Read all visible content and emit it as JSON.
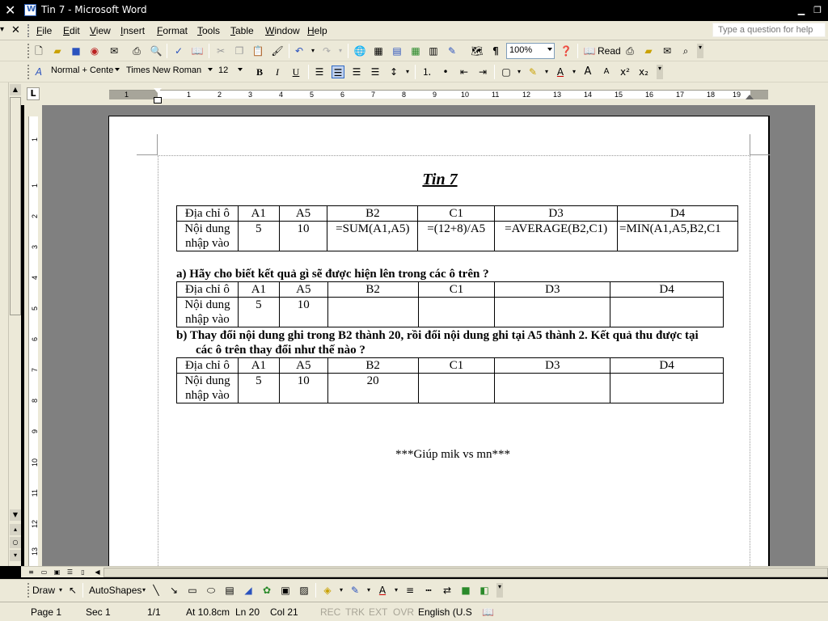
{
  "window": {
    "title": "Tin 7 - Microsoft Word"
  },
  "menu": {
    "items": [
      "File",
      "Edit",
      "View",
      "Insert",
      "Format",
      "Tools",
      "Table",
      "Window",
      "Help"
    ],
    "ask_placeholder": "Type a question for help"
  },
  "toolbar": {
    "zoom": "100%",
    "read_label": "Read",
    "style": "Normal + Cente",
    "font": "Times New Roman",
    "size": "12"
  },
  "document": {
    "title": "Tin 7",
    "table1": {
      "headers": [
        "Địa chỉ ô",
        "A1",
        "A5",
        "B2",
        "C1",
        "D3",
        "D4"
      ],
      "row_label": "Nội dung nhập vào",
      "cells": [
        "5",
        "10",
        "=SUM(A1,A5)",
        "=(12+8)/A5",
        "=AVERAGE(B2,C1)",
        "=MIN(A1,A5,B2,C1"
      ]
    },
    "question_a": "a)   Hãy cho biết kết quả gì sẽ được hiện lên trong các ô trên ?",
    "table2": {
      "headers": [
        "Địa chỉ ô",
        "A1",
        "A5",
        "B2",
        "C1",
        "D3",
        "D4"
      ],
      "row_label": "Nội dung nhập vào",
      "cells": [
        "5",
        "10",
        "",
        "",
        "",
        ""
      ]
    },
    "question_b_line1": "b)   Thay đổi nội dung ghi trong B2 thành 20, rồi đổi nội dung ghi tại A5 thành 2. Kết quả thu được tại",
    "question_b_line2": "các ô trên thay đổi như thế nào ?",
    "table3": {
      "headers": [
        "Địa chỉ ô",
        "A1",
        "A5",
        "B2",
        "C1",
        "D3",
        "D4"
      ],
      "row_label": "Nội dung nhập vào",
      "cells": [
        "5",
        "10",
        "20",
        "",
        "",
        ""
      ]
    },
    "footer_note": "***Giúp mik vs mn***"
  },
  "drawbar": {
    "draw_label": "Draw",
    "autoshapes_label": "AutoShapes"
  },
  "ruler": {
    "h_numbers": [
      "1",
      "1",
      "2",
      "3",
      "4",
      "5",
      "6",
      "7",
      "8",
      "9",
      "10",
      "11",
      "12",
      "13",
      "14",
      "15",
      "16",
      "17",
      "18",
      "19"
    ],
    "v_numbers": [
      "1",
      "1",
      "2",
      "3",
      "4",
      "5",
      "6",
      "7",
      "8",
      "9",
      "10",
      "11",
      "12",
      "13"
    ]
  },
  "status": {
    "page": "Page  1",
    "sec": "Sec  1",
    "pages": "1/1",
    "at": "At  10.8cm",
    "ln": "Ln  20",
    "col": "Col  21",
    "rec": "REC",
    "trk": "TRK",
    "ext": "EXT",
    "ovr": "OVR",
    "language": "English (U.S"
  }
}
